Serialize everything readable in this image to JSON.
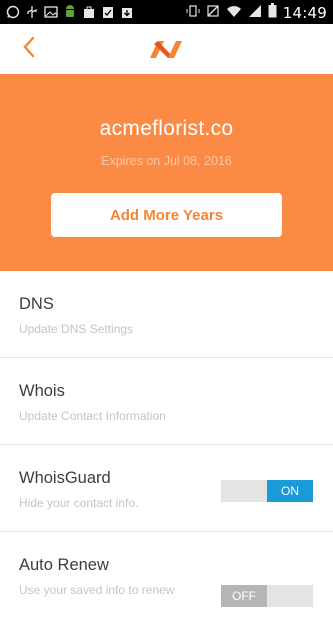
{
  "status_bar": {
    "time": "14:49",
    "left_icons": [
      "whatsapp-icon",
      "usb-icon",
      "image-icon",
      "android-icon",
      "bag-icon",
      "clipboard-check-icon",
      "download-icon"
    ],
    "right_icons": [
      "vibrate-icon",
      "no-sim-icon",
      "wifi-icon",
      "signal-icon",
      "battery-icon"
    ]
  },
  "appbar": {
    "back_icon": "chevron-left-icon",
    "logo": "namecheap-logo",
    "accent_color": "#f7842f"
  },
  "hero": {
    "domain": "acmeflorist.co",
    "expires": "Expires on Jul 08, 2016",
    "add_years_label": "Add More Years",
    "background": "#fb8a44"
  },
  "settings": {
    "dns": {
      "title": "DNS",
      "subtitle": "Update DNS Settings"
    },
    "whois": {
      "title": "Whois",
      "subtitle": "Update Contact Information"
    },
    "whoisguard": {
      "title": "WhoisGuard",
      "subtitle": "Hide your contact info.",
      "toggle_label": "ON",
      "enabled": true
    },
    "autorenew": {
      "title": "Auto Renew",
      "subtitle": "Use your saved info to renew",
      "toggle_label": "OFF",
      "enabled": false
    }
  }
}
